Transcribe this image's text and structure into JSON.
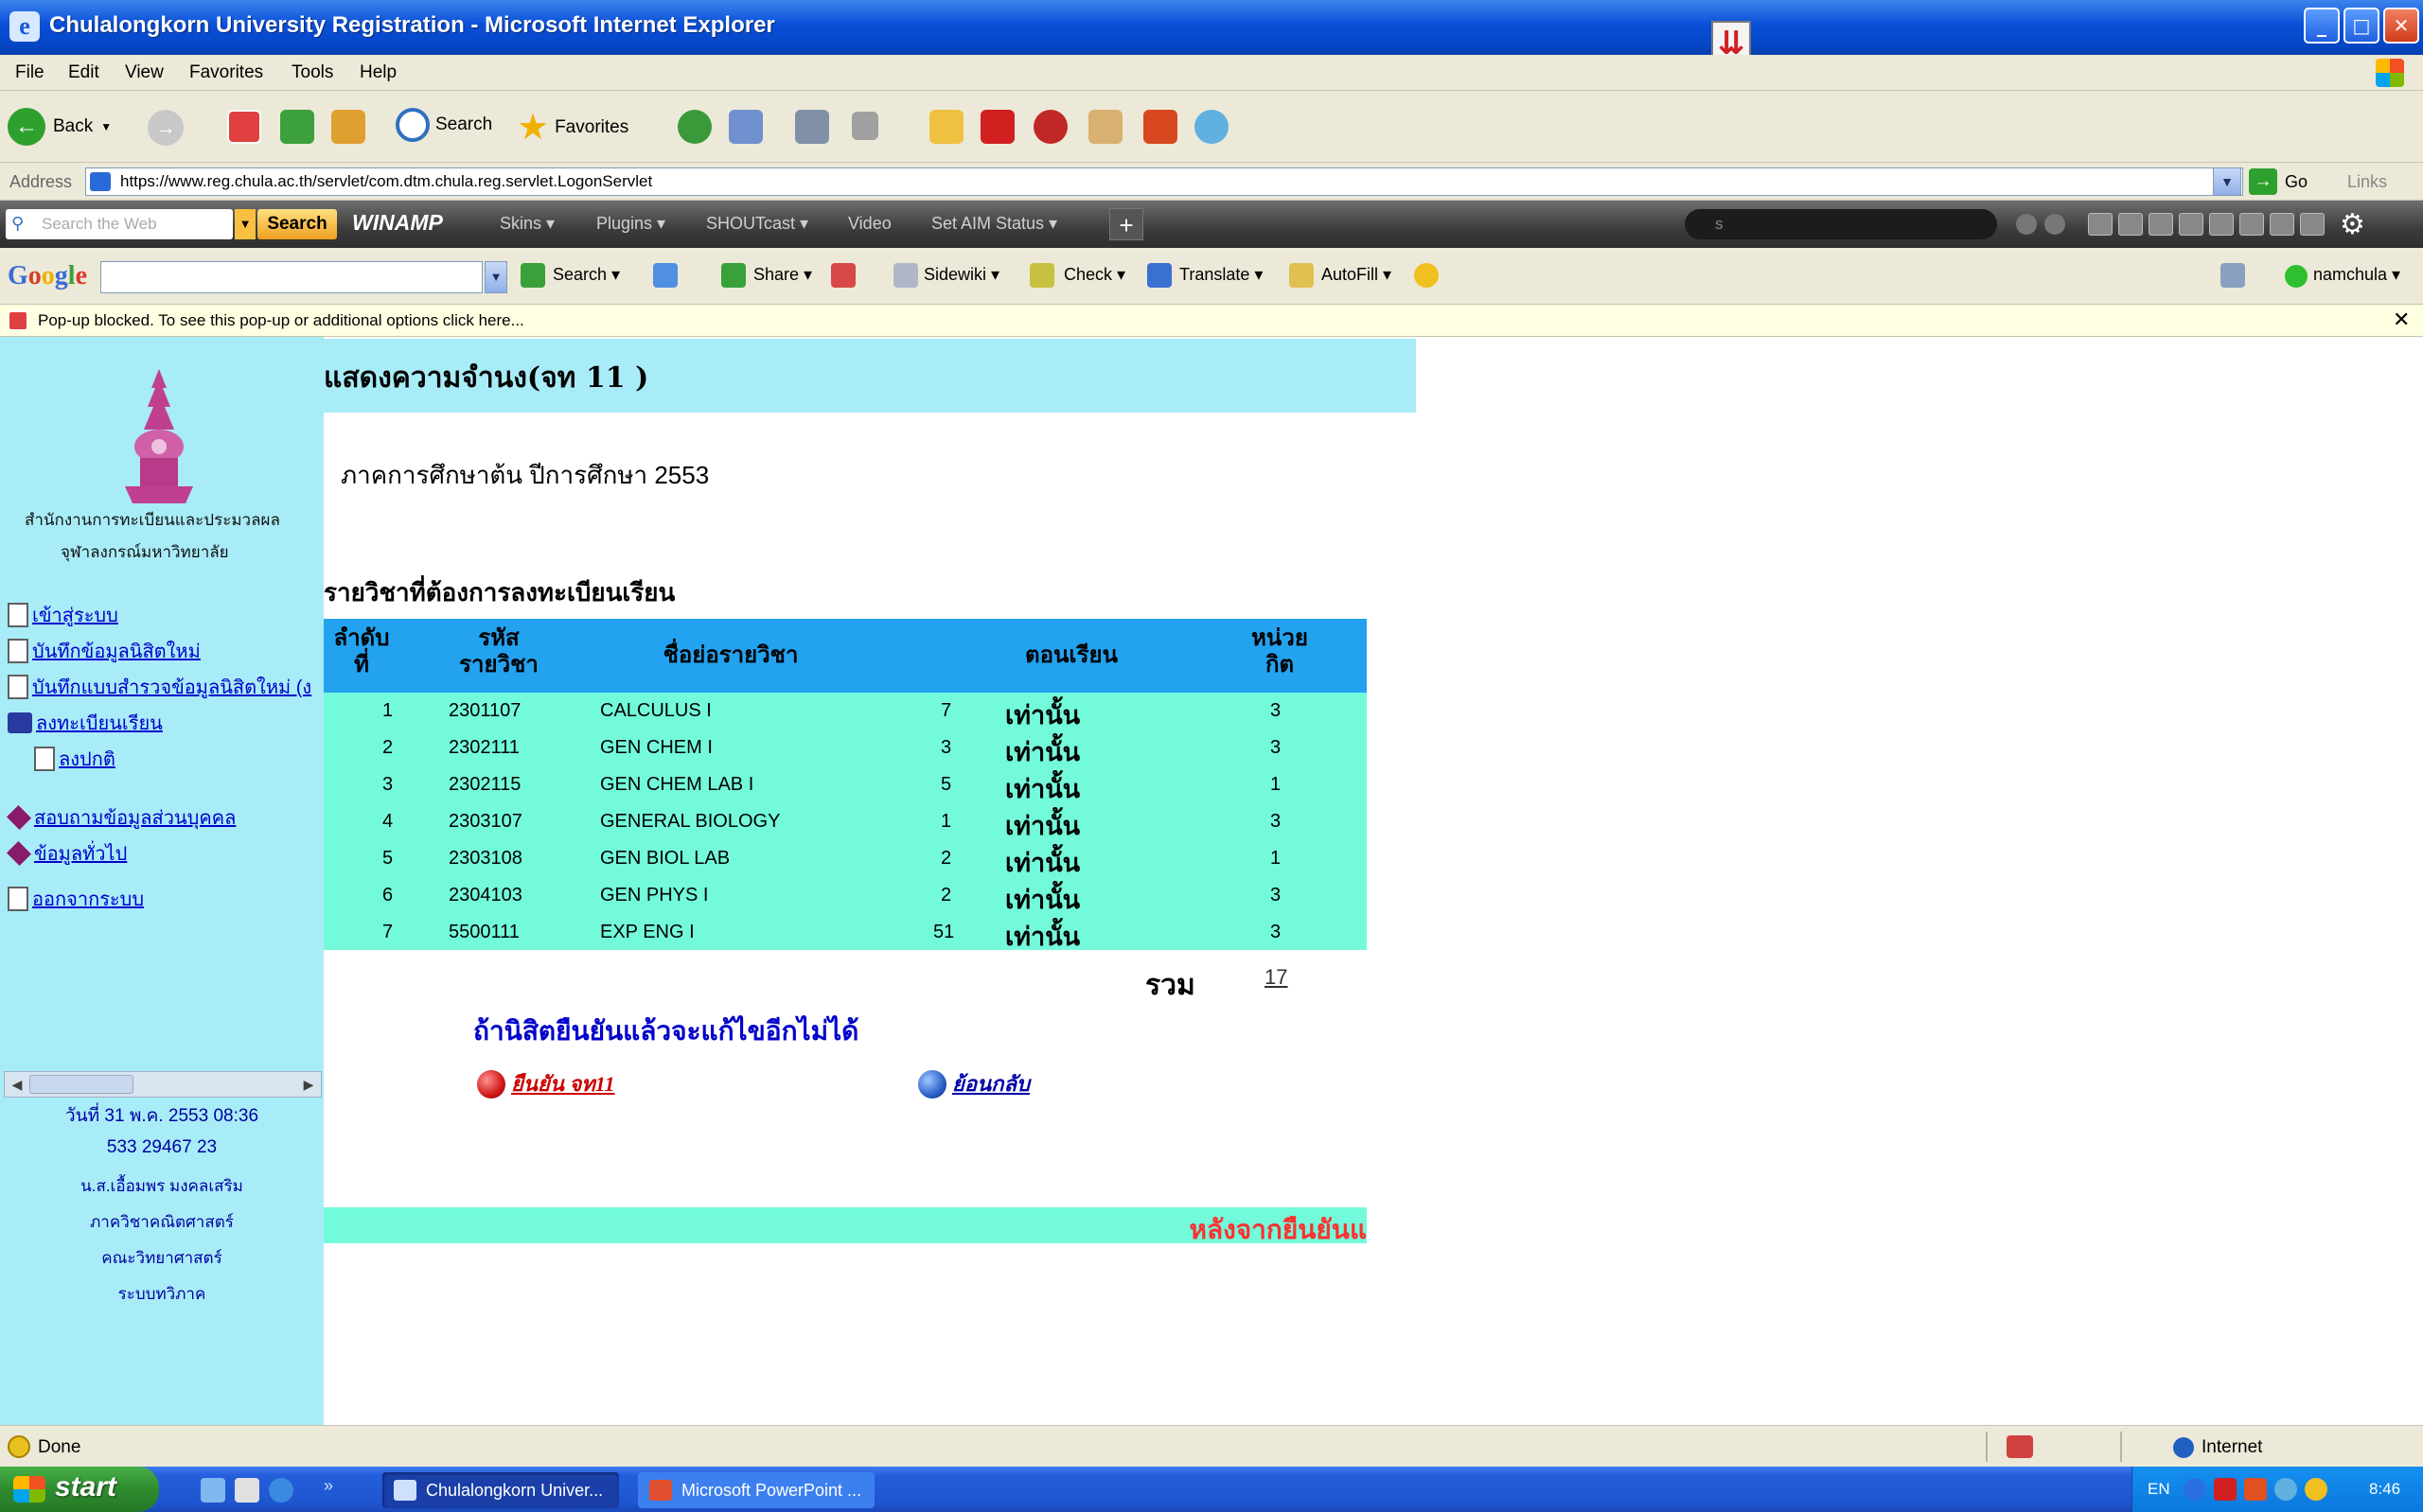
{
  "window": {
    "title": "Chulalongkorn University Registration - Microsoft Internet Explorer",
    "controls": {
      "minimize": "_",
      "maximize": "□",
      "close": "✕"
    }
  },
  "menu": [
    "File",
    "Edit",
    "View",
    "Favorites",
    "Tools",
    "Help"
  ],
  "toolbar": {
    "back": "Back",
    "search": "Search",
    "favorites": "Favorites"
  },
  "address": {
    "label": "Address",
    "url": "https://www.reg.chula.ac.th/servlet/com.dtm.chula.reg.servlet.LogonServlet",
    "go": "Go",
    "links": "Links"
  },
  "winamp_bar": {
    "search_placeholder": "Search the Web",
    "search_button": "Search",
    "logo": "WINAMP",
    "items": [
      "Skins ▾",
      "Plugins ▾",
      "SHOUTcast ▾",
      "Video",
      "Set AIM Status ▾"
    ],
    "plus": "+",
    "field_text": "s"
  },
  "google_bar": {
    "logo": "Google",
    "items": [
      "Search ▾",
      "Share ▾",
      "Sidewiki ▾",
      "Check ▾",
      "Translate ▾",
      "AutoFill ▾"
    ],
    "user": "namchula ▾"
  },
  "popup_bar": {
    "text": "Pop-up blocked. To see this pop-up or additional options click here...",
    "close": "✕"
  },
  "sidebar": {
    "org_line1": "สำนักงานการทะเบียนและประมวลผล",
    "org_line2": "จุฬาลงกรณ์มหาวิทยาลัย",
    "nav": [
      {
        "label": "เข้าสู่ระบบ",
        "icon": "doc-icon"
      },
      {
        "label": "บันทึกข้อมูลนิสิตใหม่",
        "icon": "doc-icon"
      },
      {
        "label": "บันทึกแบบสำรวจข้อมูลนิสิตใหม่ (ง",
        "icon": "doc-icon"
      },
      {
        "label": "ลงทะเบียนเรียน",
        "icon": "book-icon"
      },
      {
        "label": "ลงปกติ",
        "icon": "doc-icon"
      },
      {
        "label": "สอบถามข้อมูลส่วนบุคคล",
        "icon": "gem-icon"
      },
      {
        "label": "ข้อมูลทั่วไป",
        "icon": "gem-icon"
      },
      {
        "label": "ออกจากระบบ",
        "icon": "doc-icon"
      }
    ],
    "info": [
      "วันที่ 31 พ.ค. 2553 08:36",
      "533 29467 23",
      "น.ส.เอื้อมพร มงคลเสริม",
      "ภาควิชาคณิตศาสตร์",
      "คณะวิทยาศาสตร์",
      "ระบบทวิภาค"
    ]
  },
  "main": {
    "title": "แสดงความจำนง(จท 11 )",
    "semester": "ภาคการศึกษาต้น   ปีการศึกษา 2553",
    "section_title": "รายวิชาที่ต้องการลงทะเบียนเรียน",
    "table": {
      "headers": {
        "no_1": "ลำดับ",
        "no_2": "ที่",
        "code_1": "รหัส",
        "code_2": "รายวิชา",
        "name": "ชื่อย่อรายวิชา",
        "section": "ตอนเรียน",
        "credit_1": "หน่วย",
        "credit_2": "กิต"
      },
      "rows": [
        {
          "no": "1",
          "code": "2301107",
          "name": "CALCULUS I",
          "sec": "7",
          "sec_note": "เท่านั้น",
          "credit": "3"
        },
        {
          "no": "2",
          "code": "2302111",
          "name": "GEN CHEM I",
          "sec": "3",
          "sec_note": "เท่านั้น",
          "credit": "3"
        },
        {
          "no": "3",
          "code": "2302115",
          "name": "GEN CHEM LAB I",
          "sec": "5",
          "sec_note": "เท่านั้น",
          "credit": "1"
        },
        {
          "no": "4",
          "code": "2303107",
          "name": "GENERAL BIOLOGY",
          "sec": "1",
          "sec_note": "เท่านั้น",
          "credit": "3"
        },
        {
          "no": "5",
          "code": "2303108",
          "name": "GEN BIOL LAB",
          "sec": "2",
          "sec_note": "เท่านั้น",
          "credit": "1"
        },
        {
          "no": "6",
          "code": "2304103",
          "name": "GEN PHYS I",
          "sec": "2",
          "sec_note": "เท่านั้น",
          "credit": "3"
        },
        {
          "no": "7",
          "code": "5500111",
          "name": "EXP ENG I",
          "sec": "51",
          "sec_note": "เท่านั้น",
          "credit": "3"
        }
      ],
      "total_label": "รวม",
      "total_value": "17"
    },
    "warning": "ถ้านิสิตยืนยันแล้วจะแก้ไขอีกไม่ได้",
    "confirm_button": "ยืนยัน จท11",
    "back_button": "ย้อนกลับ",
    "after_text": "หลังจากยืนยันแ"
  },
  "status": {
    "text": "Done",
    "zone": "Internet"
  },
  "taskbar": {
    "start": "start",
    "tasks": [
      "Chulalongkorn Univer...",
      "Microsoft PowerPoint ..."
    ],
    "lang": "EN",
    "clock": "8:46"
  },
  "colors": {
    "sidebar_bg": "#a8ecf8",
    "table_header": "#23a2f0",
    "table_body": "#72fada",
    "link": "#0000cc",
    "accent_red": "#ff3030"
  }
}
